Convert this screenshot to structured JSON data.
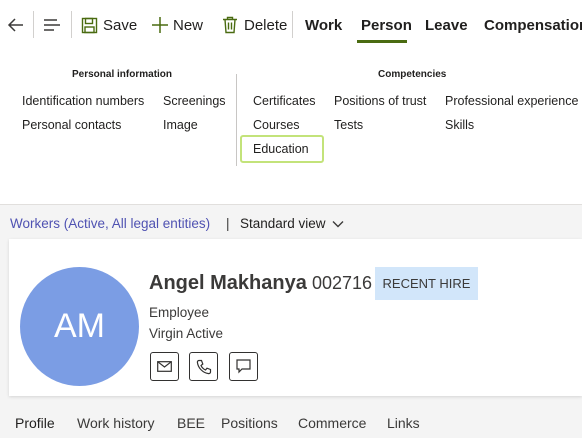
{
  "toolbar": {
    "save_label": "Save",
    "new_label": "New",
    "delete_label": "Delete",
    "tabs": [
      {
        "label": "Work"
      },
      {
        "label": "Person"
      },
      {
        "label": "Leave"
      },
      {
        "label": "Compensation"
      }
    ],
    "active_tab": "Person",
    "accent_color": "#4a6b11"
  },
  "menu": {
    "personal_information": {
      "title": "Personal information",
      "items": [
        "Identification numbers",
        "Screenings",
        "Personal contacts",
        "Image"
      ]
    },
    "competencies": {
      "title": "Competencies",
      "items": [
        "Certificates",
        "Positions of trust",
        "Professional experience",
        "Courses",
        "Tests",
        "Skills",
        "Education"
      ]
    },
    "focused_item": "Education"
  },
  "breadcrumb": {
    "filter_text": "Workers (Active, All legal entities)",
    "separator": "|",
    "view_text": "Standard view"
  },
  "worker": {
    "initials": "AM",
    "name": "Angel Makhanya",
    "id": "002716",
    "badge": "RECENT HIRE",
    "type": "Employee",
    "company": "Virgin Active",
    "avatar_color": "#7b9de4"
  },
  "bottom_tabs": [
    "Profile",
    "Work history",
    "BEE",
    "Positions",
    "Commerce",
    "Links"
  ],
  "active_bottom_tab": "Profile"
}
